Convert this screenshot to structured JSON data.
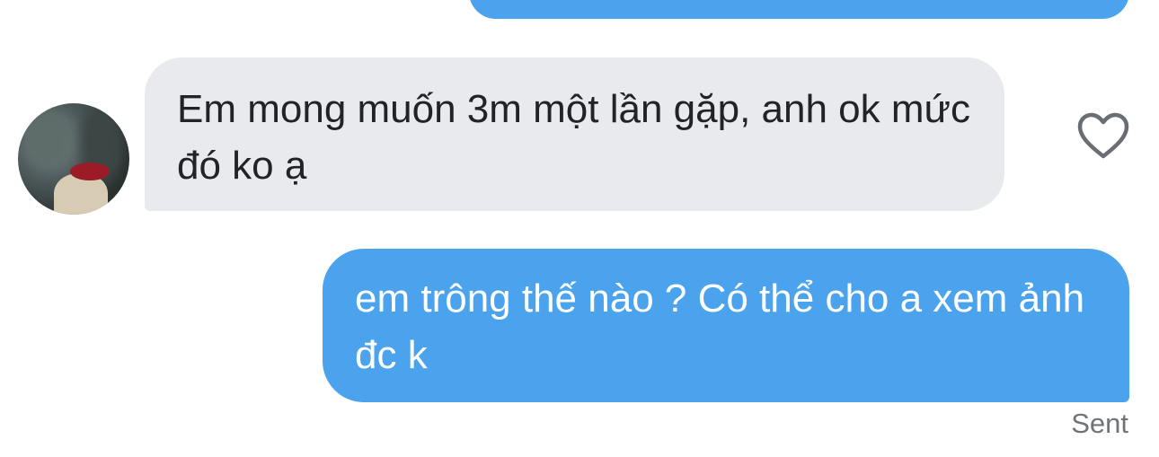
{
  "messages": [
    {
      "direction": "outgoing",
      "text": ""
    },
    {
      "direction": "incoming",
      "text": "Em mong muốn 3m một lần gặp, anh ok mức đó ko ạ",
      "liked": false
    },
    {
      "direction": "outgoing",
      "text": "em trông thế nào ? Có thể cho a xem ảnh đc k"
    }
  ],
  "status_label": "Sent",
  "icons": {
    "like": "heart-outline-icon",
    "avatar": "contact-avatar"
  },
  "colors": {
    "outgoing_bubble": "#4aa3ec",
    "incoming_bubble": "#e9eaee",
    "incoming_text": "#222326",
    "outgoing_text": "#ffffff",
    "status_text": "#707479"
  }
}
